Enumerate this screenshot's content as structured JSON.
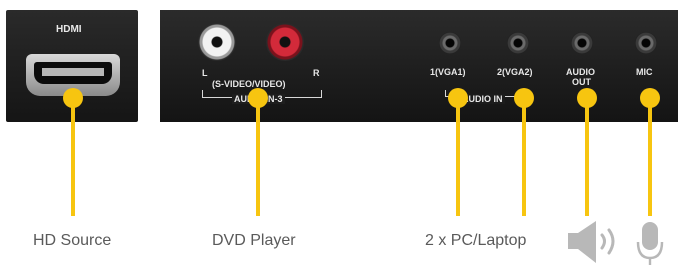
{
  "panel_labels": {
    "hdmi": "HDMI",
    "left": "L",
    "right": "R",
    "svideo": "(S-VIDEO/VIDEO)",
    "audio_in_3": "AUDIO IN-3",
    "vga1": "1(VGA1)",
    "vga2": "2(VGA2)",
    "audio_in": "AUDIO IN",
    "audio_out_1": "AUDIO",
    "audio_out_2": "OUT",
    "mic": "MIC"
  },
  "captions": {
    "hd_source": "HD Source",
    "dvd_player": "DVD Player",
    "pc_laptop": "2 x PC/Laptop"
  },
  "colors": {
    "accent": "#f7c510",
    "caption_text": "#5a5a5a",
    "icon_gray": "#b8b8b8",
    "panel": "#1c1c1c"
  },
  "icons": [
    "speaker-icon",
    "microphone-icon"
  ]
}
